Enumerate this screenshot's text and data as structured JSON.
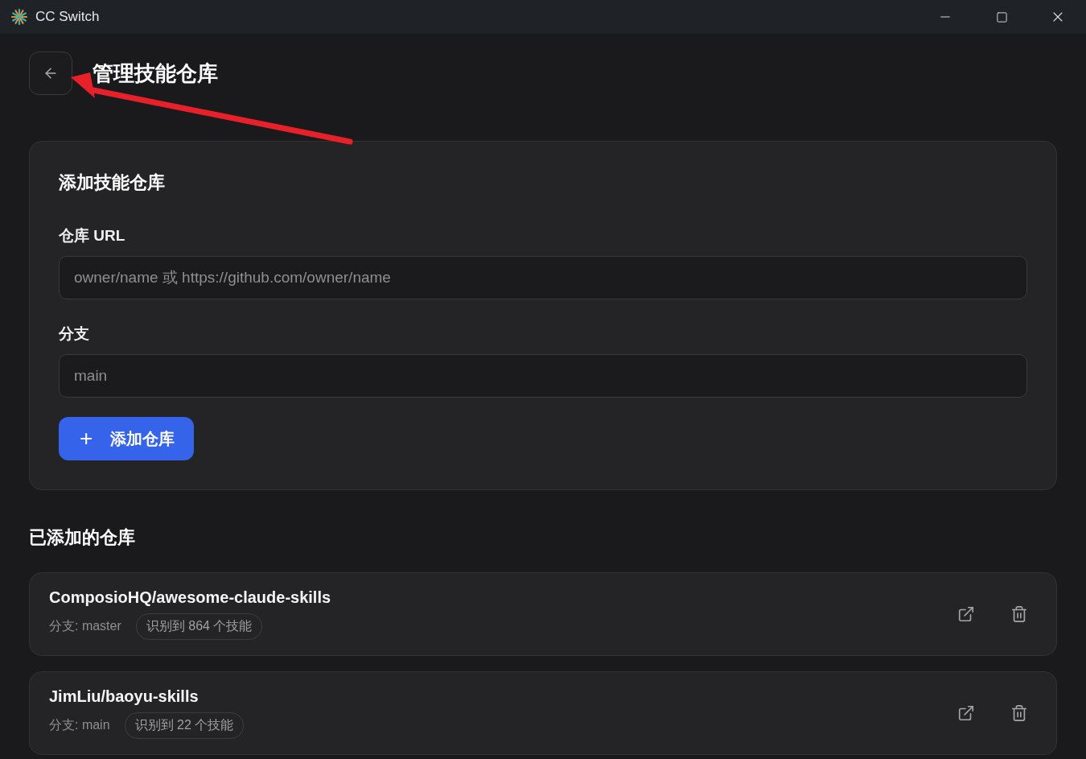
{
  "window": {
    "title": "CC Switch"
  },
  "page": {
    "title": "管理技能仓库"
  },
  "add_form": {
    "title": "添加技能仓库",
    "url_field": {
      "label": "仓库 URL",
      "placeholder": "owner/name 或 https://github.com/owner/name"
    },
    "branch_field": {
      "label": "分支",
      "placeholder": "main"
    },
    "submit": {
      "icon": "+",
      "label": "添加仓库"
    }
  },
  "repos_section": {
    "title": "已添加的仓库"
  },
  "repos": [
    {
      "name": "ComposioHQ/awesome-claude-skills",
      "branch": "分支: master",
      "count": "识别到 864 个技能"
    },
    {
      "name": "JimLiu/baoyu-skills",
      "branch": "分支: main",
      "count": "识别到 22 个技能"
    }
  ]
}
